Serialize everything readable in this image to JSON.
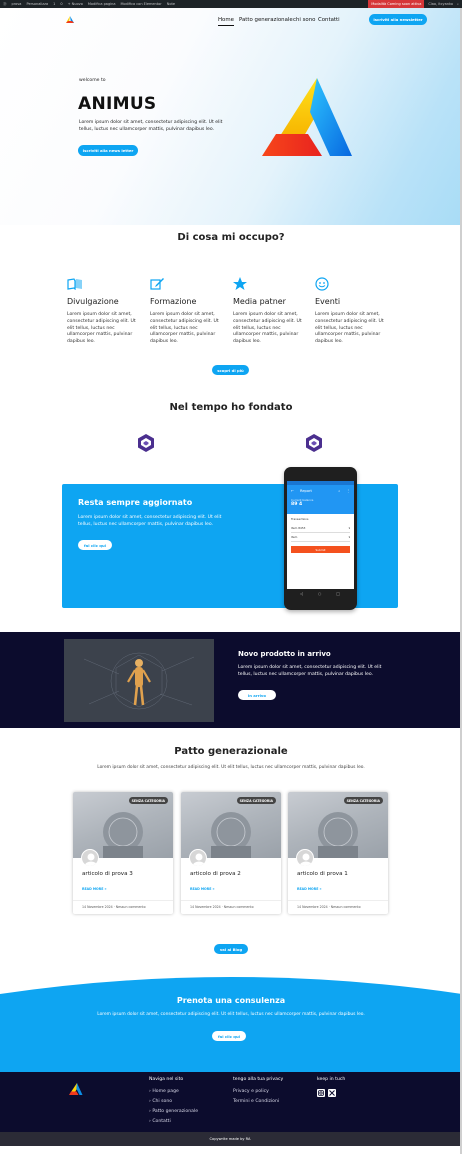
{
  "admin_bar": {
    "items": [
      "prova",
      "Personalizza",
      "1",
      "0",
      "+ Nuovo",
      "Modifica pagina",
      "Modifica con Elementor",
      "Note"
    ],
    "coming_soon": "Modalità Coming soon attiva",
    "greeting": "Ciao, itcyanko"
  },
  "nav": {
    "items": [
      "Home",
      "Patto generazionale",
      "chi sono",
      "Contatti"
    ],
    "cta": "Iscriviti alla newsletter"
  },
  "hero": {
    "welcome": "welcome to",
    "title": "ANIMUS",
    "text": "Lorem ipsum dolor sit amet, consectetur adipiscing elit. Ut elit tellus, luctus nec ullamcorper mattis, pulvinar dapibus leo.",
    "button": "Iscriviti alla news letter"
  },
  "services": {
    "heading": "Di cosa mi occupo?",
    "items": [
      {
        "icon": "book-icon",
        "title": "Divulgazione",
        "text": "Lorem ipsum dolor sit amet, consectetur adipiscing elit. Ut elit tellus, luctus nec ullamcorper mattis, pulvinar dapibus leo."
      },
      {
        "icon": "edit-icon",
        "title": "Formazione",
        "text": "Lorem ipsum dolor sit amet, consectetur adipiscing elit. Ut elit tellus, luctus nec ullamcorper mattis, pulvinar dapibus leo."
      },
      {
        "icon": "star-icon",
        "title": "Media patner",
        "text": "Lorem ipsum dolor sit amet, consectetur adipiscing elit. Ut elit tellus, luctus nec ullamcorper mattis, pulvinar dapibus leo."
      },
      {
        "icon": "smile-icon",
        "title": "Eventi",
        "text": "Lorem ipsum dolor sit amet, consectetur adipiscing elit. Ut elit tellus, luctus nec ullamcorper mattis, pulvinar dapibus leo."
      }
    ],
    "button": "scopri di più"
  },
  "founded": {
    "heading": "Nel tempo ho fondato"
  },
  "promo": {
    "title": "Resta sempre aggiornato",
    "text": "Lorem ipsum dolor sit amet, consectetur adipiscing elit. Ut elit tellus, luctus nec ullamcorper mattis, pulvinar dapibus leo.",
    "button": "fai clic qui",
    "phone": {
      "app_title": "Report",
      "balance_label": "Current balance",
      "balance": "89 4",
      "list_title": "Transactions",
      "rows": [
        "Item 8453",
        "Item"
      ],
      "button": "Submit"
    }
  },
  "product": {
    "title": "Novo prodotto in arrivo",
    "text": "Lorem ipsum dolor sit amet, consectetur adipiscing elit. Ut elit tellus, luctus nec ullamcorper mattis, pulvinar dapibus leo.",
    "button": "in arrivo"
  },
  "patto": {
    "heading": "Patto generazionale",
    "text": "Lorem ipsum dolor sit amet, consectetur adipiscing elit. Ut elit tellus, luctus nec ullamcorper mattis, pulvinar dapibus leo.",
    "cards": [
      {
        "badge": "SENZA CATEGORIA",
        "title": "articolo di prova 3",
        "more": "READ MORE »",
        "date": "14 Novembre 2024",
        "comments": "Nessun commento"
      },
      {
        "badge": "SENZA CATEGORIA",
        "title": "articolo di prova 2",
        "more": "READ MORE »",
        "date": "14 Novembre 2024",
        "comments": "Nessun commento"
      },
      {
        "badge": "SENZA CATEGORIA",
        "title": "articolo di prova 1",
        "more": "READ MORE »",
        "date": "14 Novembre 2024",
        "comments": "Nessun commento"
      }
    ],
    "blog_button": "vai al Blog"
  },
  "consult": {
    "title": "Prenota una consulenza",
    "text": "Lorem ipsum dolor sit amet, consectetur adipiscing elit. Ut elit tellus, luctus nec ullamcorper mattis, pulvinar dapibus leo.",
    "button": "fai clic qui"
  },
  "footer": {
    "nav_heading": "Naviga nel sito",
    "nav_links": [
      "Home page",
      "Chi sono",
      "Patto generazionale",
      "Contatti"
    ],
    "privacy_heading": "tengo alla tua privacy",
    "privacy_links": [
      "Privacy e policy",
      "Termini e Condizioni"
    ],
    "social_heading": "keep in tuch",
    "copyright": "Copywrite made by RA"
  },
  "colors": {
    "accent": "#0ea5f2",
    "dark": "#0c0c2d",
    "logo_yellow": "#fcd30c",
    "logo_red": "#f0391e",
    "logo_blue": "#0b8fe8"
  }
}
